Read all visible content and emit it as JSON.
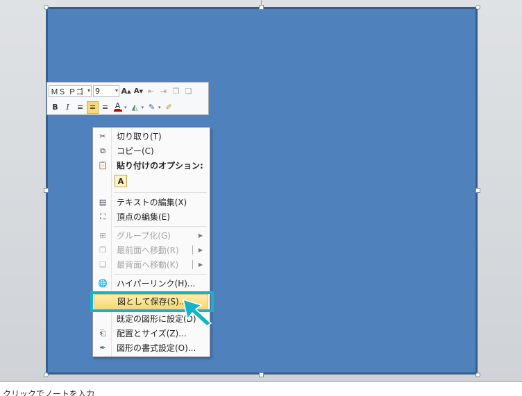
{
  "mini_toolbar": {
    "font_name": "ＭＳ Ｐゴ",
    "font_size": "9",
    "buttons_row1": [
      "grow-font",
      "shrink-font",
      "decrease-indent",
      "increase-indent",
      "bring-forward",
      "send-backward"
    ],
    "buttons_row2": {
      "bold": "B",
      "italic": "I",
      "font_color_glyph": "A"
    }
  },
  "context_menu": {
    "items": [
      {
        "label": "切り取り(T)",
        "icon": "scissors-icon",
        "enabled": true
      },
      {
        "label": "コピー(C)",
        "icon": "copy-icon",
        "enabled": true
      },
      {
        "label": "貼り付けのオプション:",
        "icon": "paste-icon",
        "enabled": true
      },
      {
        "label": "テキストの編集(X)",
        "icon": "edit-text-icon",
        "enabled": true
      },
      {
        "label": "頂点の編集(E)",
        "icon": "edit-points-icon",
        "enabled": true
      },
      {
        "label": "グループ化(G)",
        "icon": "group-icon",
        "enabled": false
      },
      {
        "label": "最前面へ移動(R)",
        "icon": "bring-to-front-icon",
        "enabled": false
      },
      {
        "label": "最背面へ移動(K)",
        "icon": "send-to-back-icon",
        "enabled": false
      },
      {
        "label": "ハイパーリンク(H)...",
        "icon": "hyperlink-icon",
        "enabled": true
      },
      {
        "label": "図として保存(S)...",
        "icon": "",
        "enabled": true
      },
      {
        "label": "既定の図形に設定(D)",
        "icon": "",
        "enabled": true
      },
      {
        "label": "配置とサイズ(Z)...",
        "icon": "size-position-icon",
        "enabled": true
      },
      {
        "label": "図形の書式設定(O)...",
        "icon": "format-shape-icon",
        "enabled": true
      }
    ],
    "paste_option_glyph": "A"
  },
  "notes": {
    "placeholder": "クリックでノートを入力"
  },
  "colors": {
    "shape_fill": "#4f81bd",
    "shape_border": "#385d8a",
    "highlight_frame": "#14b4c8",
    "menu_highlight": "#fcd86e"
  }
}
